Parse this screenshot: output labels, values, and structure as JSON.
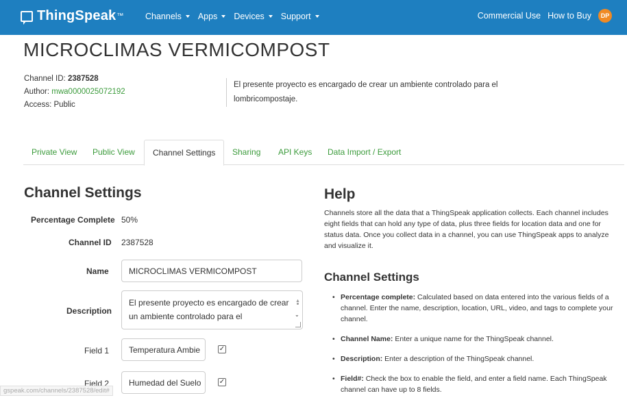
{
  "navbar": {
    "brand": "ThingSpeak",
    "brand_tm": "™",
    "menu": [
      {
        "label": "Channels"
      },
      {
        "label": "Apps"
      },
      {
        "label": "Devices"
      },
      {
        "label": "Support"
      }
    ],
    "commercial_use": "Commercial Use",
    "how_to_buy": "How to Buy",
    "avatar_initials": "DP",
    "color": "#1e7fc0",
    "avatar_color": "#f08a24"
  },
  "channel": {
    "title": "MICROCLIMAS VERMICOMPOST",
    "id_label": "Channel ID:",
    "id_value": "2387528",
    "author_label": "Author:",
    "author_value": "mwa0000025072192",
    "access_label": "Access:",
    "access_value": "Public",
    "description": "El presente proyecto es encargado de crear un ambiente controlado para el lombricompostaje."
  },
  "tabs": [
    {
      "label": "Private View",
      "active": false
    },
    {
      "label": "Public View",
      "active": false
    },
    {
      "label": "Channel Settings",
      "active": true
    },
    {
      "label": "Sharing",
      "active": false
    },
    {
      "label": "API Keys",
      "active": false
    },
    {
      "label": "Data Import / Export",
      "active": false
    }
  ],
  "settings": {
    "title": "Channel Settings",
    "percentage_label": "Percentage Complete",
    "percentage_value": "50%",
    "channel_id_label": "Channel ID",
    "channel_id_value": "2387528",
    "name_label": "Name",
    "name_value": "MICROCLIMAS VERMICOMPOST",
    "description_label": "Description",
    "description_value": "El presente proyecto es encargado de crear un ambiente controlado para el",
    "field1_label": "Field 1",
    "field1_value": "Temperatura Ambie",
    "field1_checked": true,
    "field2_label": "Field 2",
    "field2_value": "Humedad del Suelo",
    "field2_checked": true
  },
  "help": {
    "title": "Help",
    "intro": "Channels store all the data that a ThingSpeak application collects. Each channel includes eight fields that can hold any type of data, plus three fields for location data and one for status data. Once you collect data in a channel, you can use ThingSpeak apps to analyze and visualize it.",
    "subtitle": "Channel Settings",
    "items": [
      {
        "term": "Percentage complete:",
        "text": " Calculated based on data entered into the various fields of a channel. Enter the name, description, location, URL, video, and tags to complete your channel."
      },
      {
        "term": "Channel Name:",
        "text": " Enter a unique name for the ThingSpeak channel."
      },
      {
        "term": "Description:",
        "text": " Enter a description of the ThingSpeak channel."
      },
      {
        "term": "Field#:",
        "text": " Check the box to enable the field, and enter a field name. Each ThingSpeak channel can have up to 8 fields."
      }
    ]
  },
  "status_url": "gspeak.com/channels/2387528/edit#"
}
